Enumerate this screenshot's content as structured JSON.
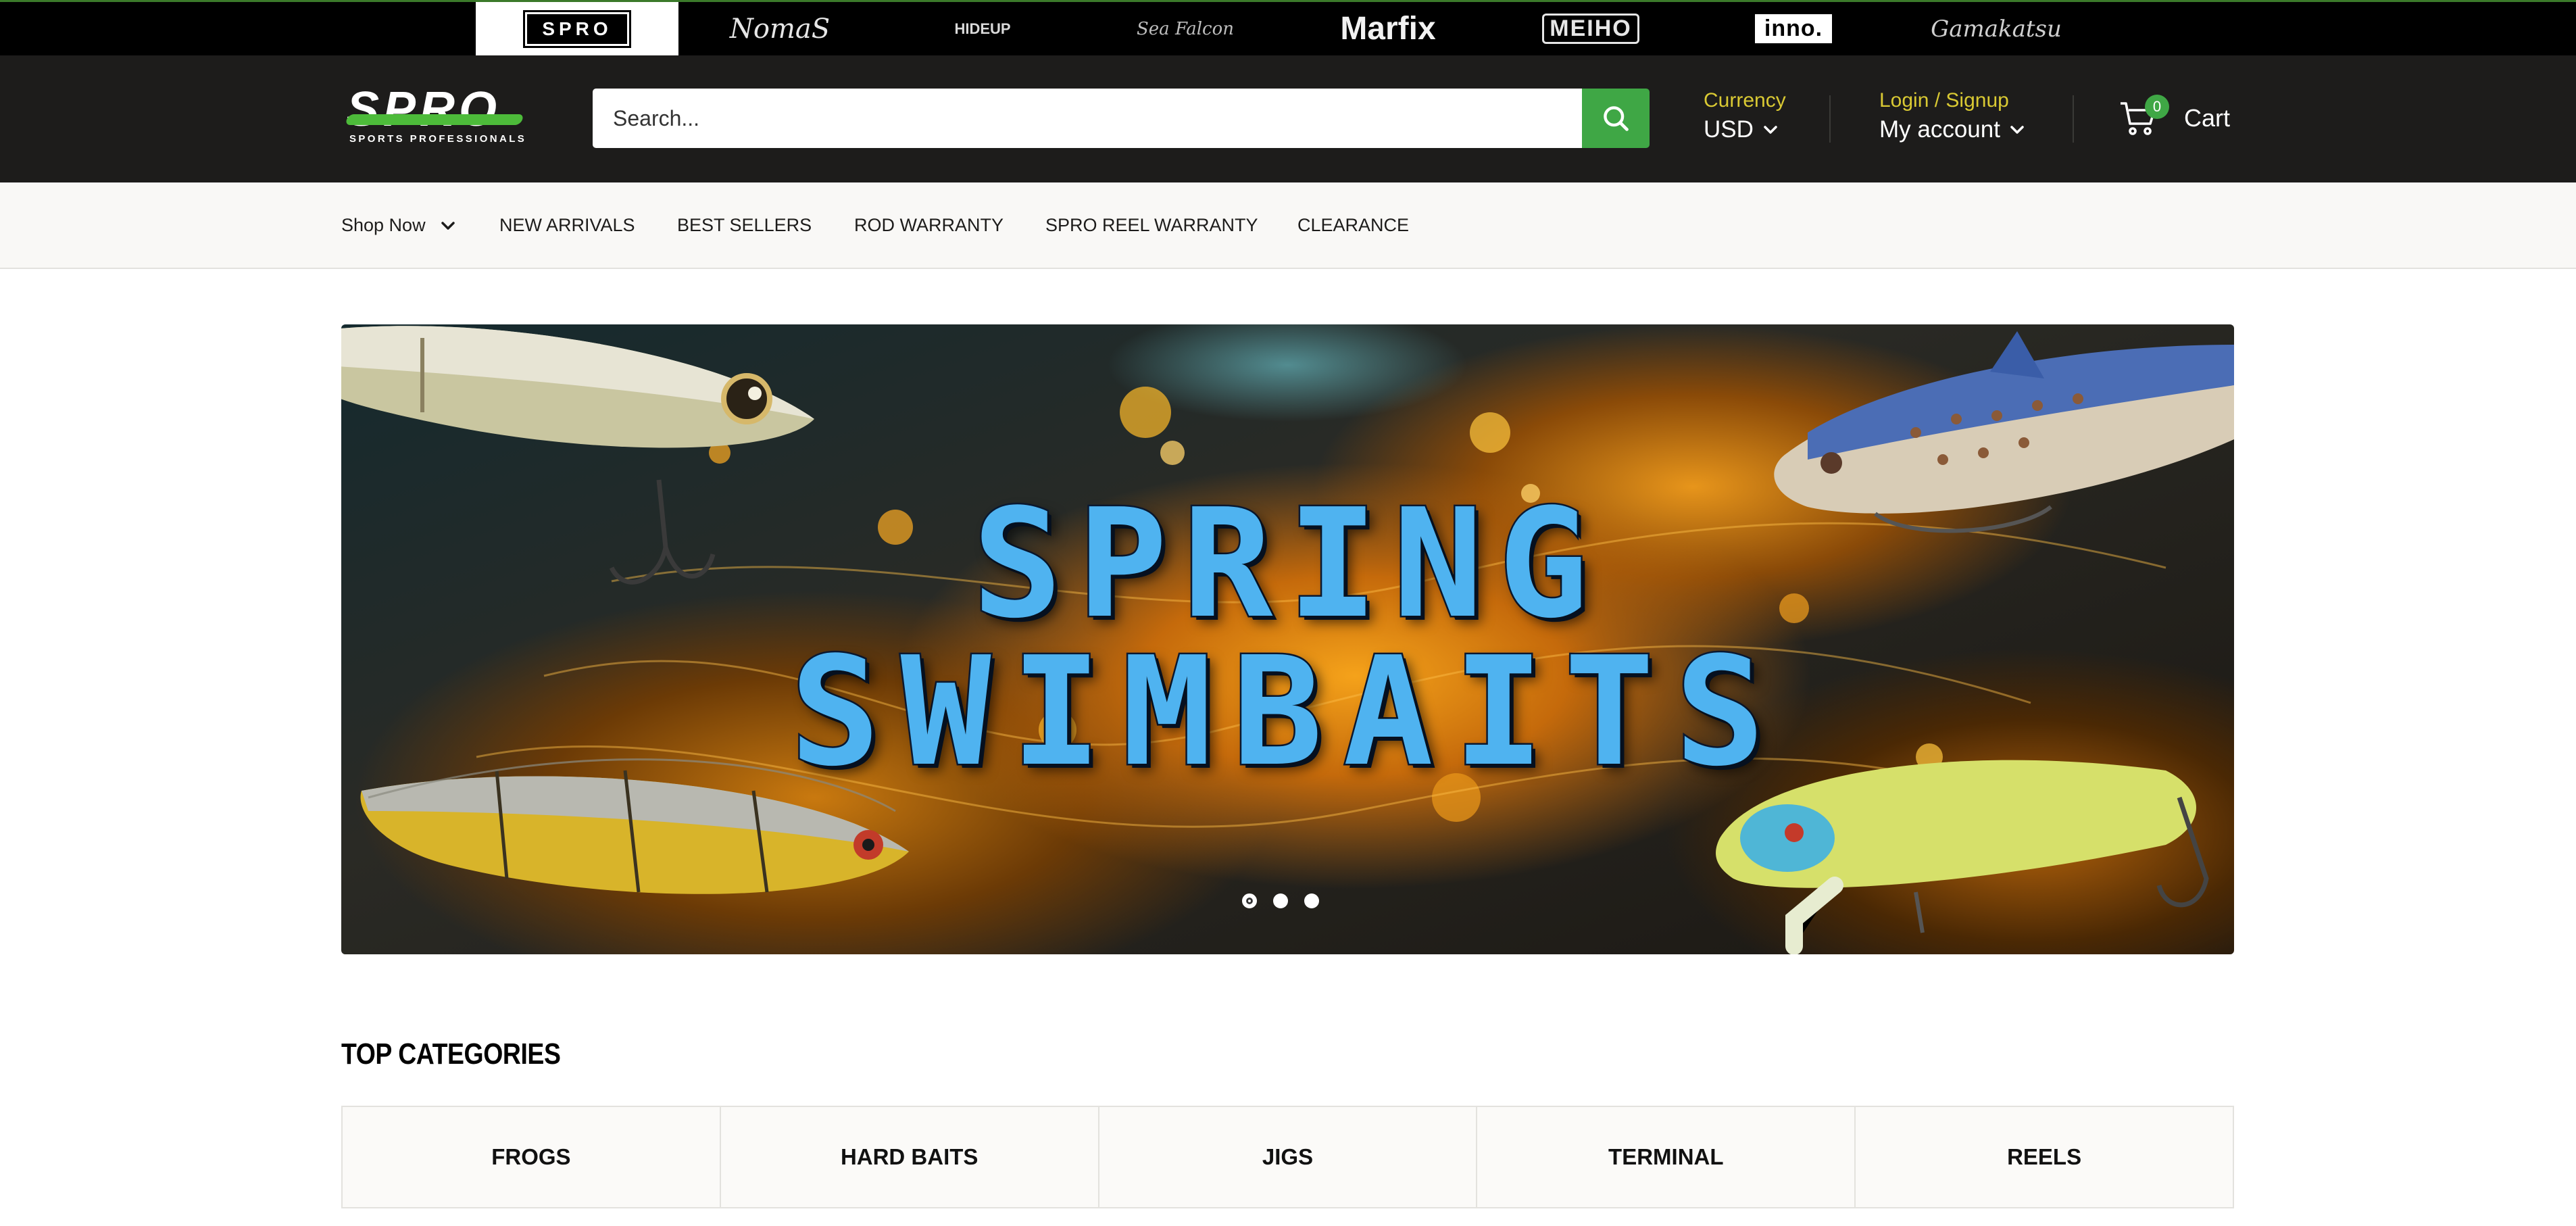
{
  "brand_strip": {
    "brands": [
      {
        "name": "SPRO",
        "tagline": "SPORTS PROFESSIONALS",
        "active": true
      },
      {
        "name": "NomaS",
        "active": false
      },
      {
        "name": "HIDEUP",
        "active": false
      },
      {
        "name": "Sea Falcon",
        "active": false
      },
      {
        "name": "Marfix",
        "active": false
      },
      {
        "name": "MEIHO",
        "active": false
      },
      {
        "name": "inno.",
        "active": false
      },
      {
        "name": "Gamakatsu",
        "active": false
      }
    ]
  },
  "header": {
    "logo": {
      "word": "SPRO",
      "tagline": "SPORTS PROFESSIONALS"
    },
    "search": {
      "placeholder": "Search...",
      "icon": "search-icon"
    },
    "currency": {
      "label": "Currency",
      "value": "USD"
    },
    "account": {
      "label": "Login / Signup",
      "value": "My account"
    },
    "cart": {
      "count": "0",
      "label": "Cart"
    },
    "colors": {
      "accent": "#3fa745",
      "highlight": "#d9c933",
      "background": "#1d1c1b"
    }
  },
  "nav": {
    "items": [
      {
        "label": "Shop Now",
        "has_dropdown": true
      },
      {
        "label": "NEW ARRIVALS"
      },
      {
        "label": "BEST SELLERS"
      },
      {
        "label": "ROD WARRANTY"
      },
      {
        "label": "SPRO REEL WARRANTY"
      },
      {
        "label": "CLEARANCE"
      }
    ]
  },
  "hero": {
    "line1": "SPRING",
    "line2": "SWIMBAITS",
    "slides_total": 3,
    "active_slide": 1
  },
  "categories": {
    "title": "TOP CATEGORIES",
    "items": [
      "FROGS",
      "HARD BAITS",
      "JIGS",
      "TERMINAL",
      "REELS"
    ]
  }
}
